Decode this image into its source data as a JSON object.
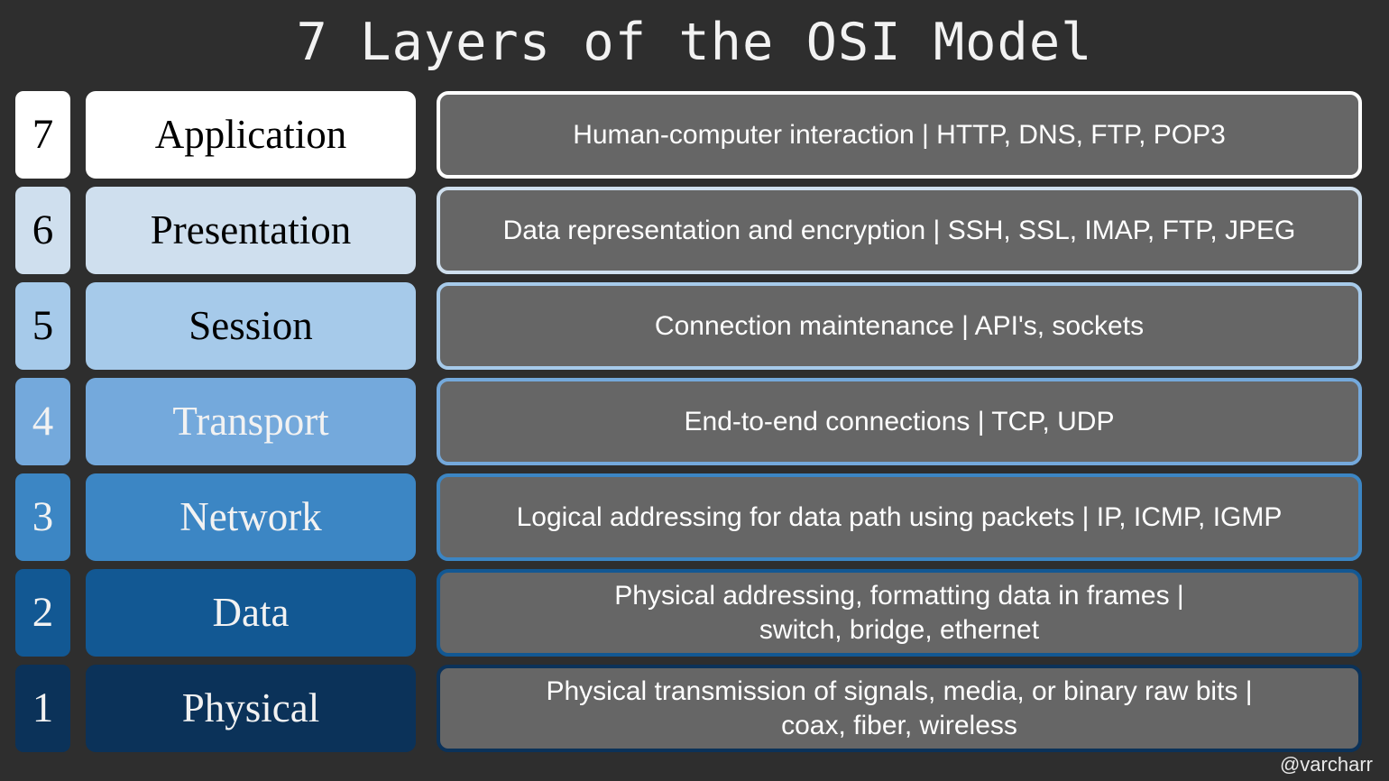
{
  "title": "7 Layers of the OSI Model",
  "watermark": "@varcharr",
  "theme": {
    "background": "#2e2e2e",
    "desc_fill": "#666666",
    "title_color": "#f2f2f2"
  },
  "layers": [
    {
      "number": "7",
      "name": "Application",
      "description": "Human-computer interaction | HTTP, DNS, FTP, POP3",
      "color": "#ffffff",
      "text_color": "#000000"
    },
    {
      "number": "6",
      "name": "Presentation",
      "description": "Data representation and encryption | SSH, SSL, IMAP, FTP, JPEG",
      "color": "#cfdfee",
      "text_color": "#000000"
    },
    {
      "number": "5",
      "name": "Session",
      "description": "Connection maintenance | API's, sockets",
      "color": "#a6caea",
      "text_color": "#000000"
    },
    {
      "number": "4",
      "name": "Transport",
      "description": "End-to-end connections | TCP, UDP",
      "color": "#74a9dc",
      "text_color": "#f2f2f2"
    },
    {
      "number": "3",
      "name": "Network",
      "description": "Logical addressing for data path using packets | IP, ICMP, IGMP",
      "color": "#3c86c4",
      "text_color": "#f2f2f2"
    },
    {
      "number": "2",
      "name": "Data",
      "description": "Physical addressing, formatting data in frames |\nswitch, bridge, ethernet",
      "color": "#125893",
      "text_color": "#f2f2f2"
    },
    {
      "number": "1",
      "name": "Physical",
      "description": "Physical transmission of signals, media, or binary raw bits |\ncoax, fiber, wireless",
      "color": "#0b3259",
      "text_color": "#f2f2f2"
    }
  ]
}
